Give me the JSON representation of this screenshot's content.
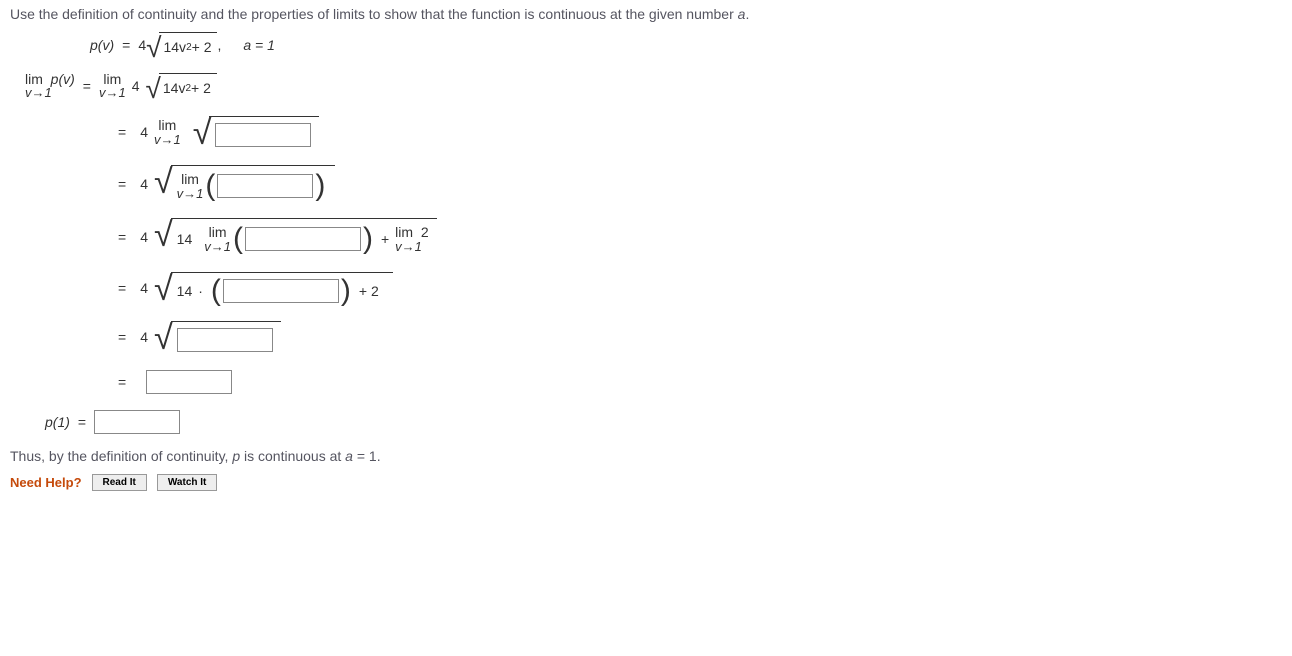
{
  "prompt": {
    "text_a": "Use the definition of continuity and the properties of limits to show that the function is continuous at the given number ",
    "var_a": "a",
    "text_b": "."
  },
  "given": {
    "p_of_v": "p(v)",
    "eq": "=",
    "four": "4",
    "rad_expr_a": "14v",
    "rad_expr_b": " + 2",
    "comma": ",",
    "a_eq": "a = 1"
  },
  "line1": {
    "lim": "lim",
    "vto1": "v→1",
    "pv": "p(v)",
    "eq": "=",
    "four": "4",
    "rad_a": "14v",
    "rad_b": " + 2"
  },
  "steps": {
    "eq": "=",
    "four": "4",
    "lim": "lim",
    "vto1": "v→1",
    "fourteen": "14",
    "plus": "+",
    "two": "2",
    "dot": "·",
    "plus2": "+ 2"
  },
  "p1": {
    "label": "p(1)",
    "eq": "="
  },
  "conclusion": {
    "a": "Thus, by the definition of continuity, ",
    "p": "p",
    "b": " is continuous at ",
    "c": "a",
    "d": " = 1."
  },
  "help": {
    "label": "Need Help?",
    "read": "Read It",
    "watch": "Watch It"
  }
}
